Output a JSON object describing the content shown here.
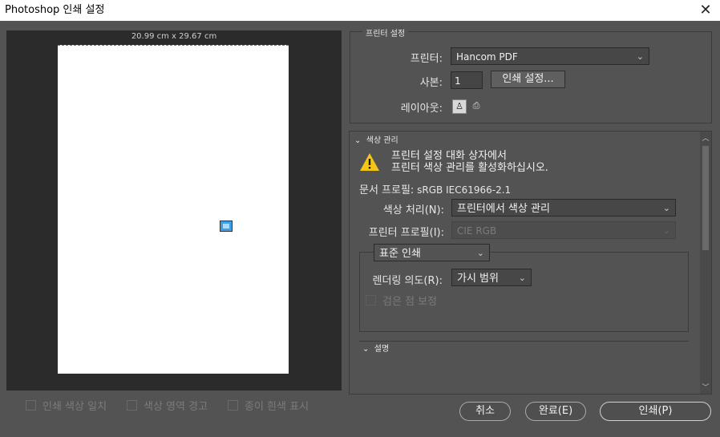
{
  "window": {
    "title": "Photoshop 인쇄 설정",
    "close_icon": "close-icon"
  },
  "preview": {
    "dimensions": "20.99 cm x 29.67 cm"
  },
  "bottom_checks": [
    {
      "label": "인쇄 색상 일치",
      "checked": false
    },
    {
      "label": "색상 영역 경고",
      "checked": false
    },
    {
      "label": "종이 흰색 표시",
      "checked": false
    }
  ],
  "printer_setup": {
    "legend": "프린터 설정",
    "printer_label": "프린터:",
    "printer_value": "Hancom PDF",
    "copies_label": "사본:",
    "copies_value": "1",
    "print_settings_button": "인쇄 설정...",
    "layout_label": "레이아웃:"
  },
  "color_management": {
    "title": "색상 관리",
    "warning_line1": "프린터 설정 대화 상자에서",
    "warning_line2": "프린터 색상 관리를 활성화하십시오.",
    "doc_profile_label": "문서 프로필:",
    "doc_profile_value": "sRGB IEC61966-2.1",
    "color_handling_label": "색상 처리(N):",
    "color_handling_value": "프린터에서 색상 관리",
    "printer_profile_label": "프린터 프로필(I):",
    "printer_profile_value": "CIE RGB",
    "print_mode_value": "표준 인쇄",
    "rendering_intent_label": "렌더링 의도(R):",
    "rendering_intent_value": "가시 범위",
    "black_point_label": "검은 점 보정"
  },
  "description": {
    "title": "설명"
  },
  "buttons": {
    "cancel": "취소",
    "done": "완료(E)",
    "print": "인쇄(P)"
  },
  "colors": {
    "bg": "#535353",
    "preview_bg": "#2b2b2b",
    "warning": "#f5c518"
  }
}
